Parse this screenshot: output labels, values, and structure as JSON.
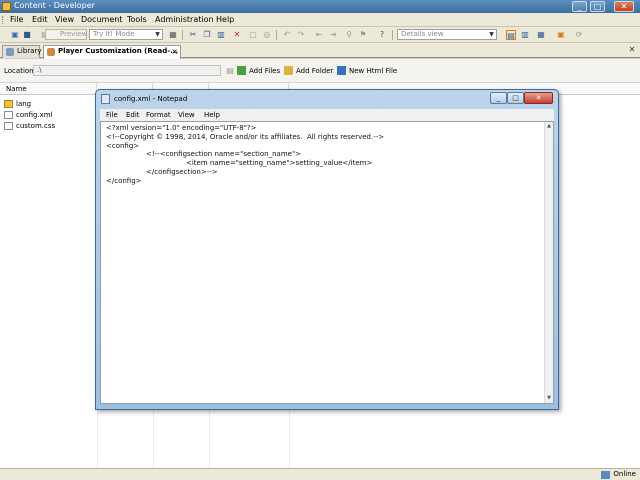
{
  "window": {
    "title": "Content - Developer"
  },
  "menu": [
    "File",
    "Edit",
    "View",
    "Document",
    "Tools",
    "Administration",
    "Help"
  ],
  "toolbar": {
    "preview_label": "Preview",
    "mode_select": "Try It! Mode",
    "view_select": "Details view"
  },
  "tabs": [
    {
      "label": "Library"
    },
    {
      "label": "Player Customization (Read-..."
    }
  ],
  "location": {
    "label": "Location:",
    "value": ".\\",
    "add_files": "Add Files",
    "add_folder": "Add Folder",
    "new_html_file": "New Html File"
  },
  "file_list": {
    "header_name": "Name",
    "files": [
      {
        "name": "lang",
        "type": "folder"
      },
      {
        "name": "config.xml",
        "type": "xml"
      },
      {
        "name": "custom.css",
        "type": "css"
      }
    ]
  },
  "status": {
    "online": "Online"
  },
  "notepad": {
    "title": "config.xml - Notepad",
    "menu": [
      "File",
      "Edit",
      "Format",
      "View",
      "Help"
    ],
    "lines": [
      "<?xml version=\"1.0\" encoding=\"UTF-8\"?>",
      "<!--Copyright © 1998, 2014, Oracle and/or its affiliates.  All rights reserved.-->",
      "<config>",
      "\t<!--<configsection name=\"section_name\">",
      "\t\t<item name=\"setting_name\">setting_value</item>",
      "\t</configsection>-->",
      "</config>"
    ]
  },
  "colors": {
    "titlebar": "#3c6e9e",
    "notepad_frame": "#9ebfe0",
    "close_button": "#c84030",
    "folder_icon": "#f0c040"
  }
}
